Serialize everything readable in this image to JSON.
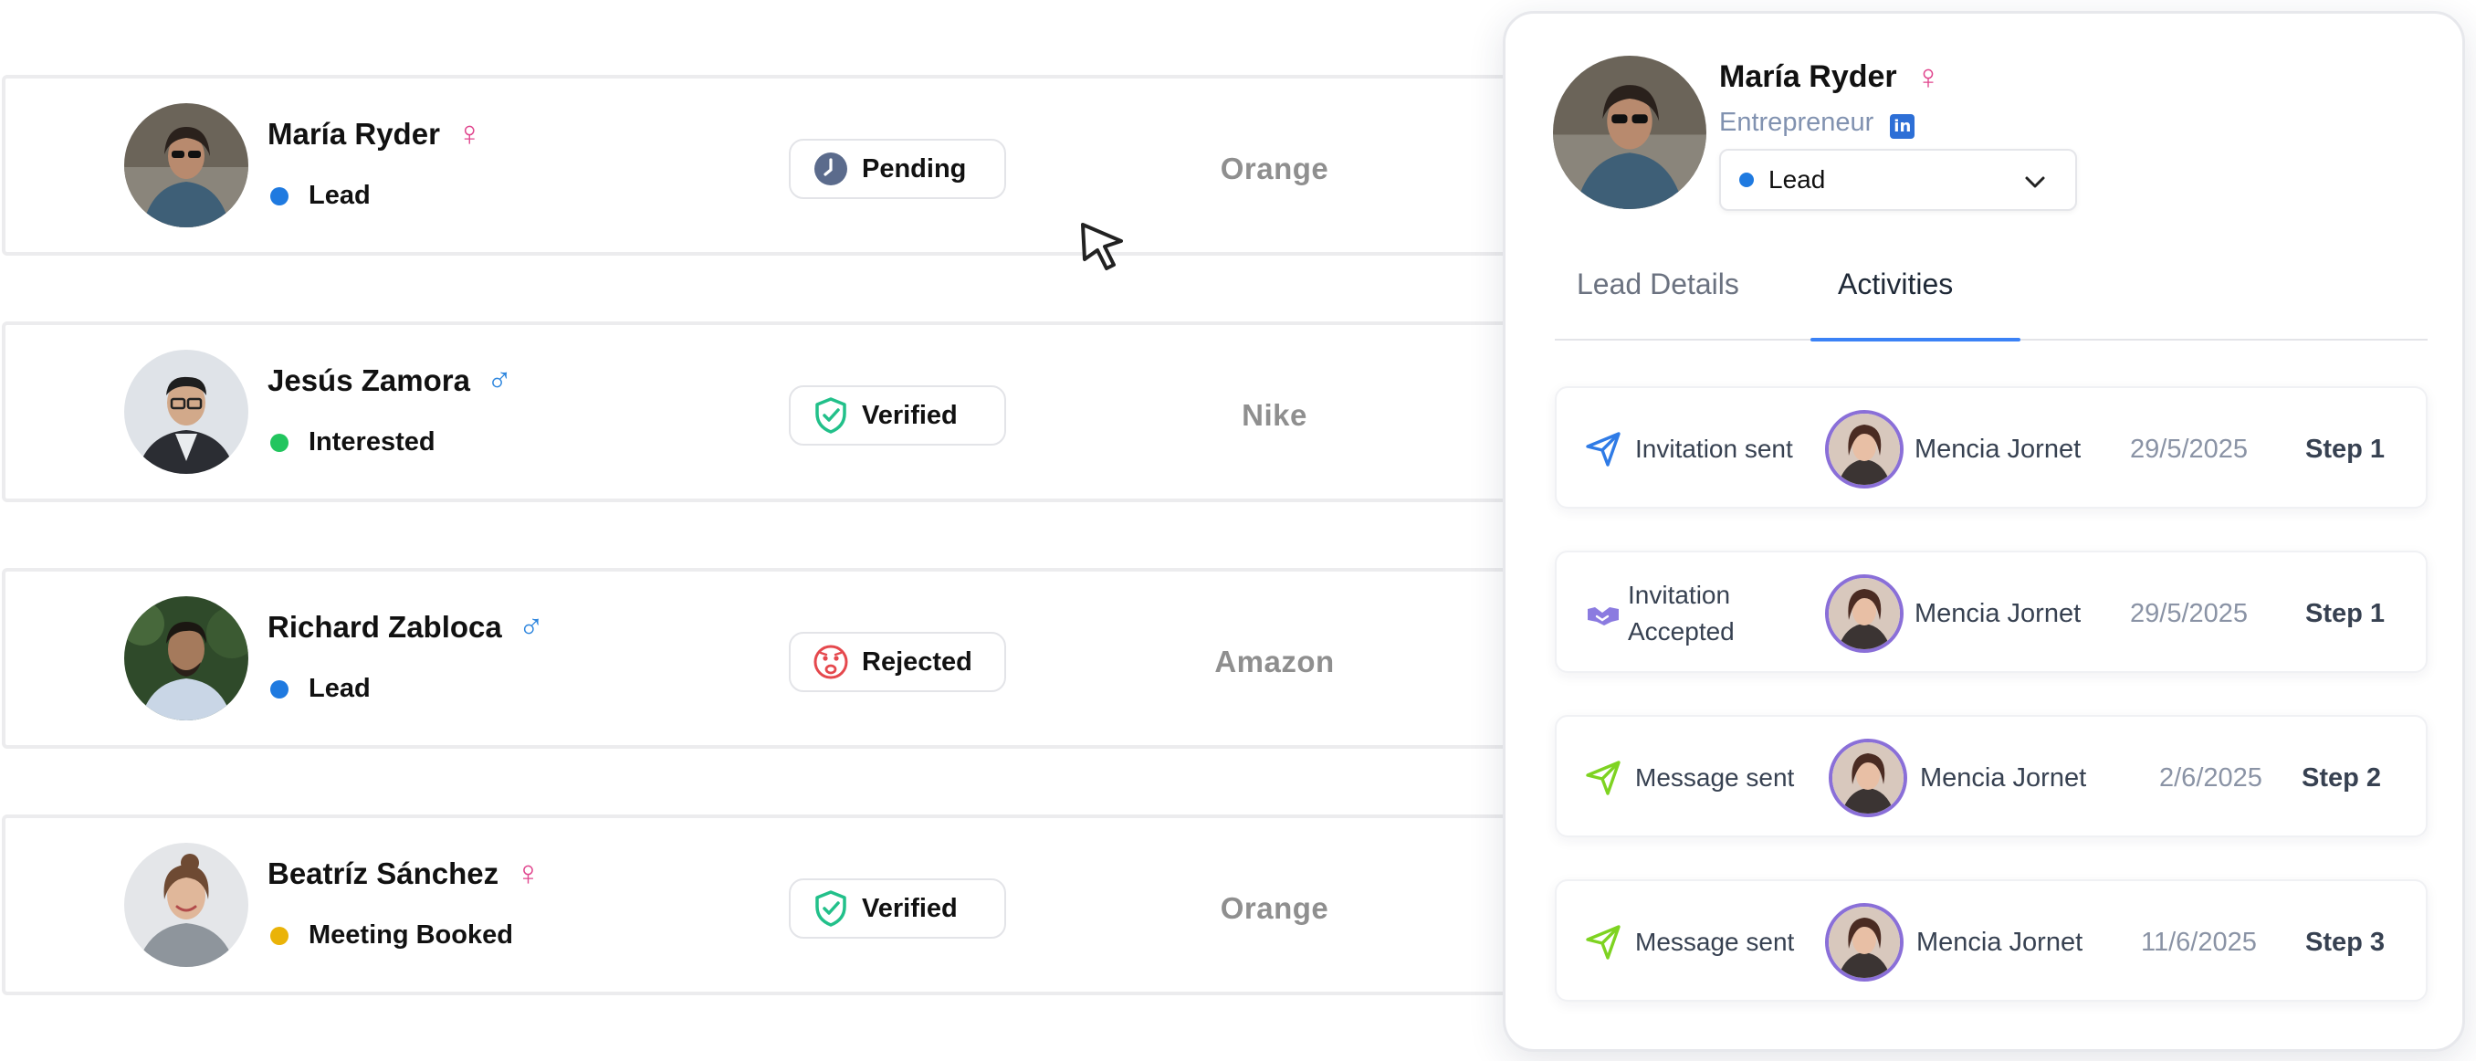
{
  "contacts": [
    {
      "name": "María Ryder",
      "gender_symbol": "♀",
      "status": "Lead",
      "status_color": "#1f7ae0",
      "verification": "Pending",
      "company": "Orange"
    },
    {
      "name": "Jesús Zamora",
      "gender_symbol": "♂",
      "status": "Interested",
      "status_color": "#22c55e",
      "verification": "Verified",
      "company": "Nike"
    },
    {
      "name": "Richard Zabloca",
      "gender_symbol": "♂",
      "status": "Lead",
      "status_color": "#1f7ae0",
      "verification": "Rejected",
      "company": "Amazon"
    },
    {
      "name": "Beatríz Sánchez",
      "gender_symbol": "♀",
      "status": "Meeting Booked",
      "status_color": "#eab308",
      "verification": "Verified",
      "company": "Orange"
    }
  ],
  "panel": {
    "name": "María Ryder",
    "gender_symbol": "♀",
    "role": "Entrepreneur",
    "linkedin_icon": "in",
    "status_value": "Lead",
    "tabs": [
      {
        "label": "Lead Details",
        "active": false
      },
      {
        "label": "Activities",
        "active": true
      }
    ],
    "activities": [
      {
        "icon": "send-icon",
        "label_line1": "Invitation sent",
        "label_line2": "",
        "user": "Mencia Jornet",
        "date": "29/5/2025",
        "step": "Step 1"
      },
      {
        "icon": "handshake-icon",
        "label_line1": "Invitation",
        "label_line2": "Accepted",
        "user": "Mencia Jornet",
        "date": "29/5/2025",
        "step": "Step 1"
      },
      {
        "icon": "message-send-icon",
        "label_line1": "Message sent",
        "label_line2": "",
        "user": "Mencia Jornet",
        "date": "2/6/2025",
        "step": "Step 2"
      },
      {
        "icon": "message-send-icon",
        "label_line1": "Message sent",
        "label_line2": "",
        "user": "Mencia Jornet",
        "date": "11/6/2025",
        "step": "Step 3"
      }
    ]
  },
  "colors": {
    "accent": "#3b82f6",
    "verified": "#22c08a",
    "pending": "#5b6b8c",
    "rejected": "#e5484d",
    "female": "#e0468e",
    "male": "#2e86de"
  }
}
